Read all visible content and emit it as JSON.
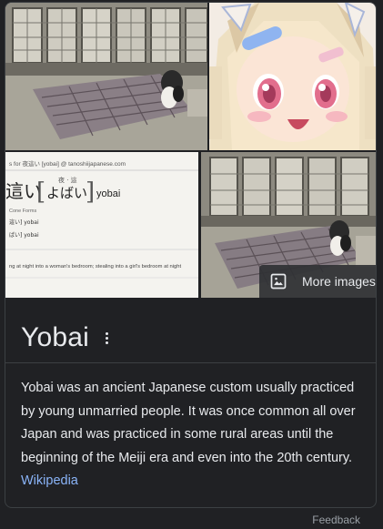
{
  "gallery": {
    "images": [
      {
        "subject": "traditional Japanese room with futon and figure"
      },
      {
        "subject": "anime character illustration"
      },
      {
        "subject": "dictionary entry screenshot"
      },
      {
        "subject": "traditional Japanese room with futon"
      }
    ],
    "more_images_label": "More images",
    "more_images_icon": "image-icon"
  },
  "dictionary": {
    "source": "s for 夜這い [yobai] @ tanoshiijapanese.com",
    "kanji_partial": "這い",
    "furigana": "夜 · 這",
    "kana": "よばい",
    "romaji": "yobai",
    "lines": [
      "Cone Forms",
      "這い]   yobai",
      "ばい]   yobai",
      "ng at night into a woman's bedroom; stealing into a girl's bedroom at night"
    ]
  },
  "entity": {
    "title": "Yobai",
    "more_icon": "more-vert-icon",
    "description": "Yobai was an ancient Japanese custom usually practiced by young unmarried people. It was once common all over Japan and was practiced in some rural areas until the beginning of the Meiji era and even into the 20th century.",
    "source_link": "Wikipedia"
  },
  "footer": {
    "feedback_label": "Feedback"
  },
  "colors": {
    "background": "#202124",
    "border": "#3c4043",
    "text": "#e8eaed",
    "link": "#8ab4f8",
    "muted": "#9aa0a6"
  }
}
